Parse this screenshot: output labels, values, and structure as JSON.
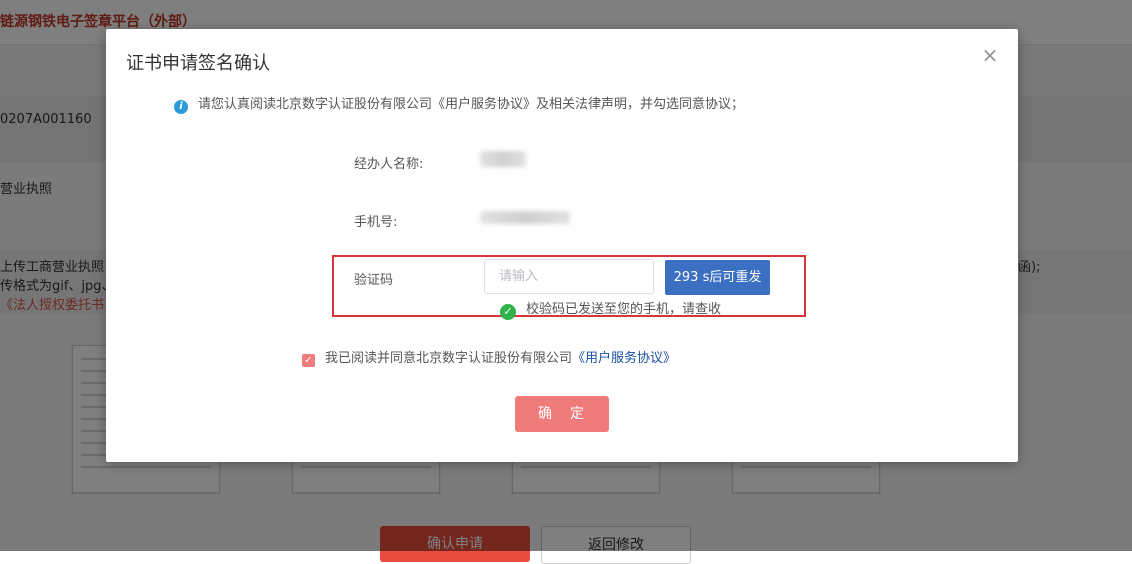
{
  "background": {
    "platform_title": "链源钢铁电子签章平台（外部）",
    "code_value": "0207A001160",
    "license_label": "营业执照",
    "upload_line1": "上传工商营业执照",
    "upload_line2": "传格式为gif、jpg、",
    "upload_line3": "《法人授权委托书",
    "right_fragment": "函);",
    "confirm_apply_label": "确认申请",
    "go_back_label": "返回修改"
  },
  "modal": {
    "title": "证书申请签名确认",
    "close_icon": "×",
    "notice": "请您认真阅读北京数字认证股份有限公司《用户服务协议》及相关法律声明，并勾选同意协议；",
    "handler_label": "经办人名称:",
    "phone_label": "手机号:",
    "code_label": "验证码",
    "code_placeholder": "请输入",
    "code_value": "",
    "resend_label": "293 s后可重发",
    "sent_message": "校验码已发送至您的手机，请查收",
    "agree_text": "我已阅读并同意北京数字认证股份有限公司",
    "agree_link": "《用户服务协议》",
    "agree_checked": true,
    "confirm_label": "确　定"
  },
  "colors": {
    "accent_blue": "#3a6fc2",
    "highlight_red": "#d9343a",
    "confirm_pink": "#f07b7b",
    "success_green": "#2fb34a",
    "info_blue": "#2d9cdb"
  }
}
